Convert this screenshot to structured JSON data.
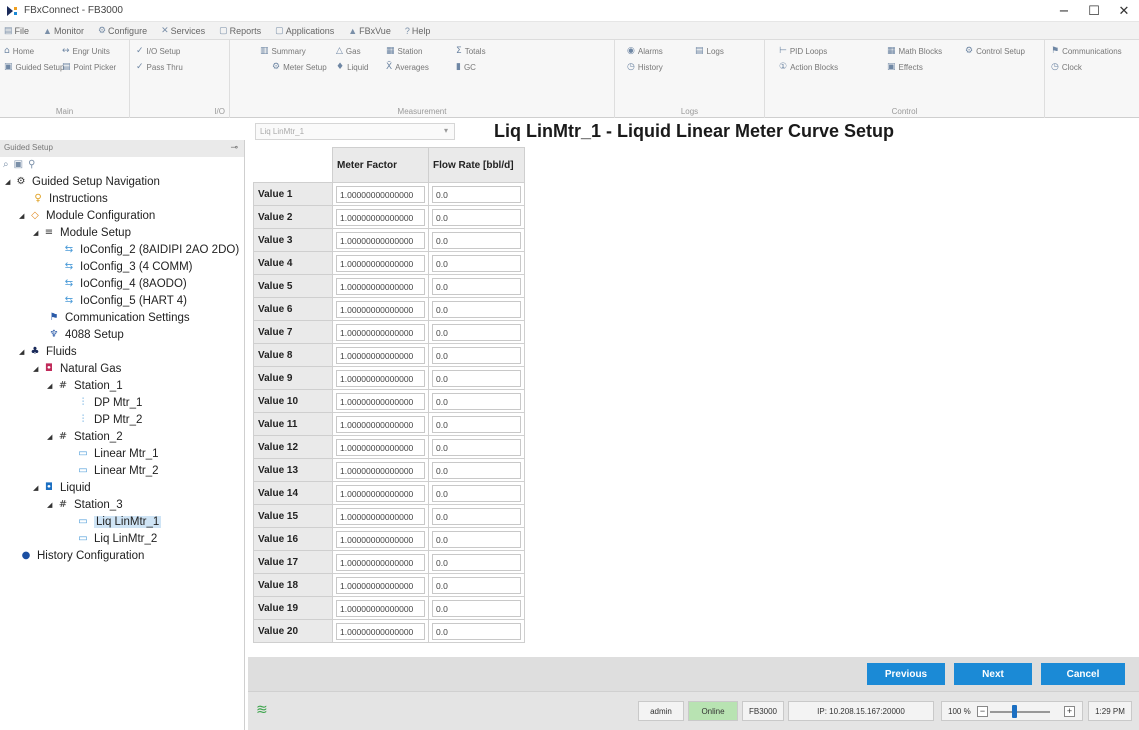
{
  "window": {
    "title": "FBxConnect - FB3000",
    "minimize": "−",
    "maximize": "☐",
    "close": "✕"
  },
  "menu": {
    "tabs": [
      {
        "icon": "▤",
        "label": "File"
      },
      {
        "icon": "▲",
        "label": "Monitor"
      },
      {
        "icon": "⚙",
        "label": "Configure"
      },
      {
        "icon": "✕",
        "label": "Services"
      },
      {
        "icon": "▢",
        "label": "Reports"
      },
      {
        "icon": "▢",
        "label": "Applications"
      },
      {
        "icon": "▲",
        "label": "FBxVue"
      },
      {
        "icon": "?",
        "label": "Help"
      }
    ]
  },
  "ribbon": {
    "main": {
      "label": "Main",
      "home": "Home",
      "engr_units": "Engr Units",
      "guided_setup": "Guided Setup",
      "point_picker": "Point Picker"
    },
    "io": {
      "label": "I/O",
      "io_setup": "I/O Setup",
      "pass_thru": "Pass Thru"
    },
    "measurement": {
      "label": "Measurement",
      "summary": "Summary",
      "gas": "Gas",
      "station": "Station",
      "totals": "Totals",
      "meter_setup": "Meter Setup",
      "liquid": "Liquid",
      "averages": "Averages",
      "gc": "GC"
    },
    "logs": {
      "label": "Logs",
      "alarms": "Alarms",
      "logs": "Logs",
      "history": "History"
    },
    "control": {
      "label": "Control",
      "pid_loops": "PID Loops",
      "math_blocks": "Math Blocks",
      "control_setup": "Control Setup",
      "action_blocks": "Action Blocks",
      "effects": "Effects"
    },
    "extra": {
      "communications": "Communications",
      "clock": "Clock"
    }
  },
  "left_panel": {
    "title": "Guided Setup",
    "tree": [
      {
        "label": "Guided Setup Navigation"
      },
      {
        "label": "Instructions"
      },
      {
        "label": "Module Configuration"
      },
      {
        "label": "Module Setup"
      },
      {
        "label": "IoConfig_2 (8AIDIPI 2AO 2DO)"
      },
      {
        "label": "IoConfig_3 (4 COMM)"
      },
      {
        "label": "IoConfig_4 (8AODO)"
      },
      {
        "label": "IoConfig_5 (HART 4)"
      },
      {
        "label": "Communication Settings"
      },
      {
        "label": "4088 Setup"
      },
      {
        "label": "Fluids"
      },
      {
        "label": "Natural Gas"
      },
      {
        "label": "Station_1"
      },
      {
        "label": "DP Mtr_1"
      },
      {
        "label": "DP Mtr_2"
      },
      {
        "label": "Station_2"
      },
      {
        "label": "Linear Mtr_1"
      },
      {
        "label": "Linear Mtr_2"
      },
      {
        "label": "Liquid"
      },
      {
        "label": "Station_3"
      },
      {
        "label": "Liq LinMtr_1"
      },
      {
        "label": "Liq LinMtr_2"
      },
      {
        "label": "History Configuration"
      }
    ]
  },
  "main": {
    "meter_select": "Liq LinMtr_1",
    "page_title": "Liq LinMtr_1 - Liquid Linear Meter Curve Setup",
    "columns": {
      "meter_factor": "Meter Factor",
      "flow_rate": "Flow Rate [bbl/d]"
    },
    "rows": [
      {
        "label": "Value 1",
        "meter_factor": "1.00000000000000",
        "flow_rate": "0.0"
      },
      {
        "label": "Value 2",
        "meter_factor": "1.00000000000000",
        "flow_rate": "0.0"
      },
      {
        "label": "Value 3",
        "meter_factor": "1.00000000000000",
        "flow_rate": "0.0"
      },
      {
        "label": "Value 4",
        "meter_factor": "1.00000000000000",
        "flow_rate": "0.0"
      },
      {
        "label": "Value 5",
        "meter_factor": "1.00000000000000",
        "flow_rate": "0.0"
      },
      {
        "label": "Value 6",
        "meter_factor": "1.00000000000000",
        "flow_rate": "0.0"
      },
      {
        "label": "Value 7",
        "meter_factor": "1.00000000000000",
        "flow_rate": "0.0"
      },
      {
        "label": "Value 8",
        "meter_factor": "1.00000000000000",
        "flow_rate": "0.0"
      },
      {
        "label": "Value 9",
        "meter_factor": "1.00000000000000",
        "flow_rate": "0.0"
      },
      {
        "label": "Value 10",
        "meter_factor": "1.00000000000000",
        "flow_rate": "0.0"
      },
      {
        "label": "Value 11",
        "meter_factor": "1.00000000000000",
        "flow_rate": "0.0"
      },
      {
        "label": "Value 12",
        "meter_factor": "1.00000000000000",
        "flow_rate": "0.0"
      },
      {
        "label": "Value 13",
        "meter_factor": "1.00000000000000",
        "flow_rate": "0.0"
      },
      {
        "label": "Value 14",
        "meter_factor": "1.00000000000000",
        "flow_rate": "0.0"
      },
      {
        "label": "Value 15",
        "meter_factor": "1.00000000000000",
        "flow_rate": "0.0"
      },
      {
        "label": "Value 16",
        "meter_factor": "1.00000000000000",
        "flow_rate": "0.0"
      },
      {
        "label": "Value 17",
        "meter_factor": "1.00000000000000",
        "flow_rate": "0.0"
      },
      {
        "label": "Value 18",
        "meter_factor": "1.00000000000000",
        "flow_rate": "0.0"
      },
      {
        "label": "Value 19",
        "meter_factor": "1.00000000000000",
        "flow_rate": "0.0"
      },
      {
        "label": "Value 20",
        "meter_factor": "1.00000000000000",
        "flow_rate": "0.0"
      }
    ]
  },
  "actions": {
    "previous": "Previous",
    "next": "Next",
    "cancel": "Cancel"
  },
  "status": {
    "user": "admin",
    "connection": "Online",
    "device": "FB3000",
    "ip": "IP: 10.208.15.167:20000",
    "zoom": "100 %",
    "zoom_level": 0.4,
    "time": "1:29 PM"
  },
  "colors": {
    "accent": "#1b8ad6",
    "online": "#b8e3b2",
    "selected": "#cfe4f5"
  }
}
